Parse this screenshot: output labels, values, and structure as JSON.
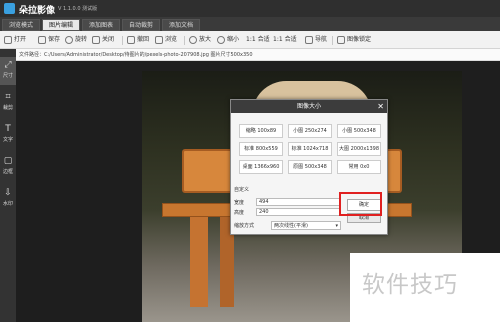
{
  "app": {
    "name": "朵拉影像",
    "version": "V 1.1.0.0 测试版"
  },
  "tabs": [
    {
      "label": "浏览模式"
    },
    {
      "label": "图片编辑"
    },
    {
      "label": "添加图表"
    },
    {
      "label": "自动裁剪"
    },
    {
      "label": "添加文档"
    }
  ],
  "toolbar": {
    "open": "打开",
    "save": "保存",
    "rotate": "旋转",
    "close": "关闭",
    "undo": "撤回",
    "browse": "浏览",
    "zoom_in": "放大",
    "zoom_out": "缩小",
    "fit": "1:1 合适",
    "actual": "1:1 合适",
    "navigator": "导航",
    "lock_ratio": "图像锁定"
  },
  "path_bar": {
    "text": "文件路径：C:/Users/Administrator/Desktop/待图片的/pexels-photo-207908.jpg   图片尺寸500x350"
  },
  "sidebar": [
    {
      "label": "尺寸",
      "glyph": "⤢"
    },
    {
      "label": "裁剪",
      "glyph": "⌗"
    },
    {
      "label": "文字",
      "glyph": "T"
    },
    {
      "label": "边框",
      "glyph": "▢"
    },
    {
      "label": "水印",
      "glyph": "⇩"
    }
  ],
  "dialog": {
    "title": "图像大小",
    "close_glyph": "✕",
    "presets": [
      {
        "label": "缩略 100x89"
      },
      {
        "label": "小图 250x274"
      },
      {
        "label": "小图 500x348"
      },
      {
        "label": "标准 800x559"
      },
      {
        "label": "标准 1024x718"
      },
      {
        "label": "大图 2000x1398"
      },
      {
        "label": "桌面 1366x960"
      },
      {
        "label": "原图 500x348"
      },
      {
        "label": "常用 0x0"
      }
    ],
    "custom_label": "自定义",
    "width_label": "宽度",
    "width_value": "494",
    "height_label": "高度",
    "height_value": "240",
    "scale_label": "缩放方式",
    "scale_value": "两次线性(平滑)",
    "ok_label": "确定",
    "cancel_label": "取消",
    "highlight_color": "#e02020"
  },
  "watermark": {
    "text": "软件技巧"
  }
}
